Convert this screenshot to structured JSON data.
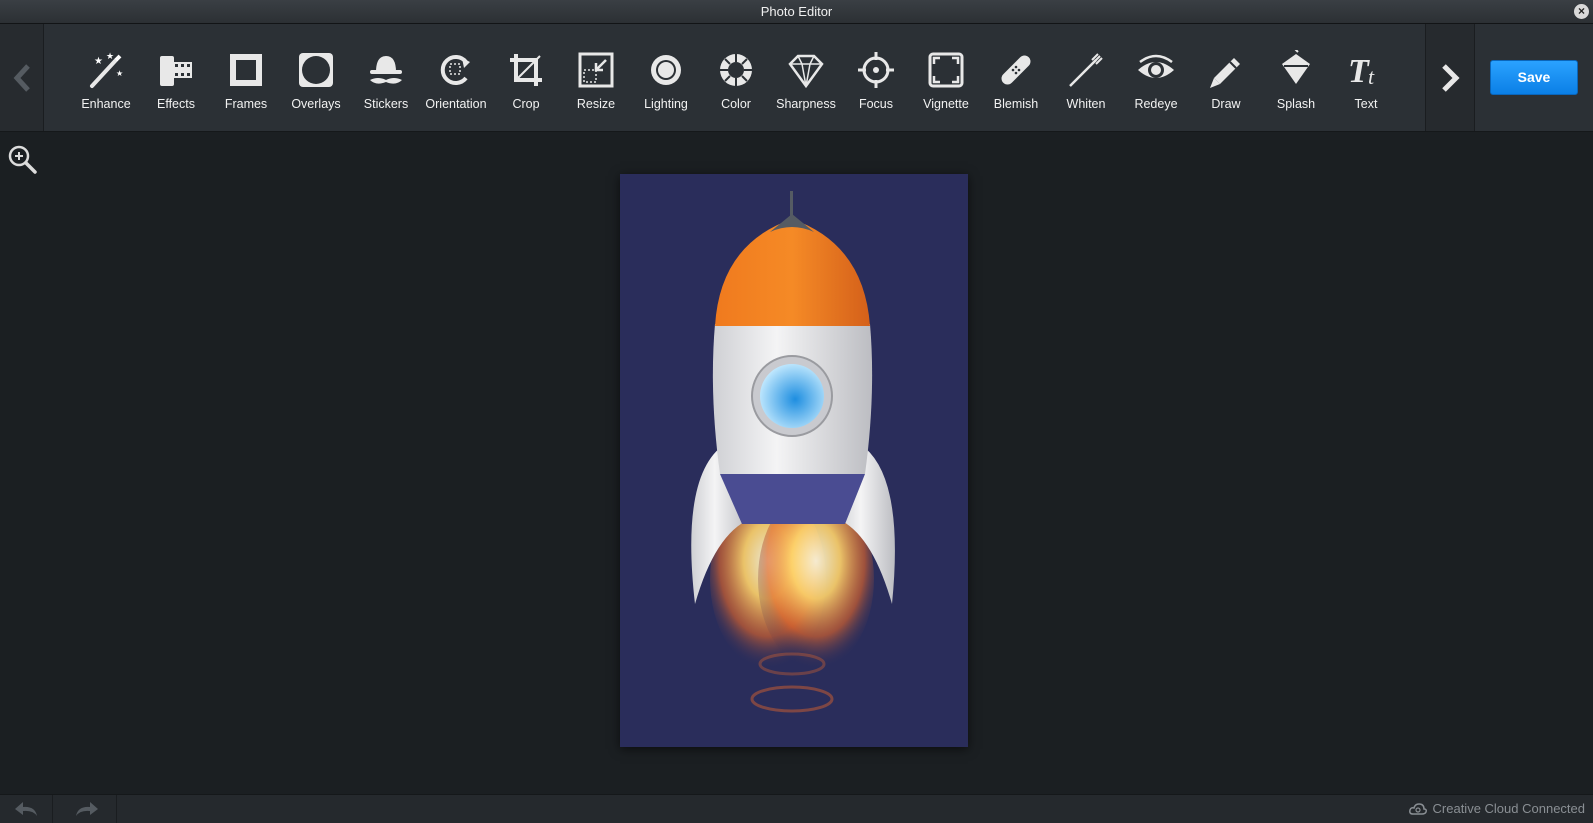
{
  "window": {
    "title": "Photo Editor",
    "close_label": "×"
  },
  "toolbar": {
    "tools": [
      {
        "label": "Enhance",
        "icon": "magic-wand-icon"
      },
      {
        "label": "Effects",
        "icon": "film-icon"
      },
      {
        "label": "Frames",
        "icon": "frame-icon"
      },
      {
        "label": "Overlays",
        "icon": "overlay-icon"
      },
      {
        "label": "Stickers",
        "icon": "mustache-hat-icon"
      },
      {
        "label": "Orientation",
        "icon": "rotate-icon"
      },
      {
        "label": "Crop",
        "icon": "crop-icon"
      },
      {
        "label": "Resize",
        "icon": "resize-icon"
      },
      {
        "label": "Lighting",
        "icon": "sun-icon"
      },
      {
        "label": "Color",
        "icon": "color-wheel-icon"
      },
      {
        "label": "Sharpness",
        "icon": "diamond-icon"
      },
      {
        "label": "Focus",
        "icon": "crosshair-icon"
      },
      {
        "label": "Vignette",
        "icon": "vignette-icon"
      },
      {
        "label": "Blemish",
        "icon": "bandage-icon"
      },
      {
        "label": "Whiten",
        "icon": "toothbrush-icon"
      },
      {
        "label": "Redeye",
        "icon": "eye-icon"
      },
      {
        "label": "Draw",
        "icon": "pencil-icon"
      },
      {
        "label": "Splash",
        "icon": "paint-bucket-icon"
      },
      {
        "label": "Text",
        "icon": "text-icon"
      }
    ],
    "save_label": "Save"
  },
  "status": {
    "cloud_label": "Creative Cloud Connected"
  },
  "colors": {
    "accent": "#1a90f5",
    "canvas_bg": "#2a2d5b",
    "rocket_orange": "#f07a1e"
  }
}
